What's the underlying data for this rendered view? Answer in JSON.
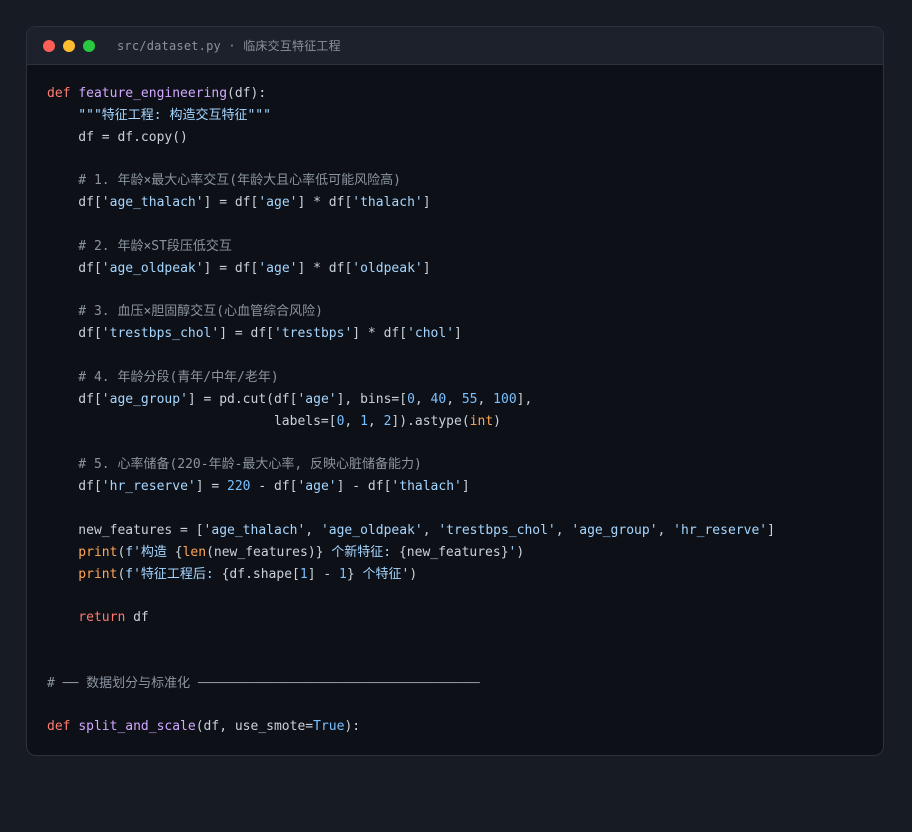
{
  "window": {
    "title": "src/dataset.py · 临床交互特征工程",
    "colors": {
      "close": "#ff5f57",
      "minimize": "#febc2e",
      "maximize": "#28c840",
      "background": "#0d1017",
      "keyword": "#ff7b72",
      "function": "#d2a8ff",
      "string": "#a5d6ff",
      "number": "#79c0ff",
      "comment": "#8b949e",
      "builtin": "#ffa657",
      "plain": "#c9d1d9"
    }
  },
  "code": {
    "lines": [
      [
        [
          "kw",
          "def "
        ],
        [
          "fn",
          "feature_engineering"
        ],
        [
          "pl",
          "(df):"
        ]
      ],
      [
        [
          "str",
          "    \"\"\"特征工程: 构造交互特征\"\"\""
        ]
      ],
      [
        [
          "pl",
          "    df = df.copy()"
        ]
      ],
      [],
      [
        [
          "cm",
          "    # 1. 年龄×最大心率交互(年龄大且心率低可能风险高)"
        ]
      ],
      [
        [
          "pl",
          "    df["
        ],
        [
          "str",
          "'age_thalach'"
        ],
        [
          "pl",
          "] = df["
        ],
        [
          "str",
          "'age'"
        ],
        [
          "pl",
          "] * df["
        ],
        [
          "str",
          "'thalach'"
        ],
        [
          "pl",
          "]"
        ]
      ],
      [],
      [
        [
          "cm",
          "    # 2. 年龄×ST段压低交互"
        ]
      ],
      [
        [
          "pl",
          "    df["
        ],
        [
          "str",
          "'age_oldpeak'"
        ],
        [
          "pl",
          "] = df["
        ],
        [
          "str",
          "'age'"
        ],
        [
          "pl",
          "] * df["
        ],
        [
          "str",
          "'oldpeak'"
        ],
        [
          "pl",
          "]"
        ]
      ],
      [],
      [
        [
          "cm",
          "    # 3. 血压×胆固醇交互(心血管综合风险)"
        ]
      ],
      [
        [
          "pl",
          "    df["
        ],
        [
          "str",
          "'trestbps_chol'"
        ],
        [
          "pl",
          "] = df["
        ],
        [
          "str",
          "'trestbps'"
        ],
        [
          "pl",
          "] * df["
        ],
        [
          "str",
          "'chol'"
        ],
        [
          "pl",
          "]"
        ]
      ],
      [],
      [
        [
          "cm",
          "    # 4. 年龄分段(青年/中年/老年)"
        ]
      ],
      [
        [
          "pl",
          "    df["
        ],
        [
          "str",
          "'age_group'"
        ],
        [
          "pl",
          "] = pd.cut(df["
        ],
        [
          "str",
          "'age'"
        ],
        [
          "pl",
          "], bins=["
        ],
        [
          "num",
          "0"
        ],
        [
          "pl",
          ", "
        ],
        [
          "num",
          "40"
        ],
        [
          "pl",
          ", "
        ],
        [
          "num",
          "55"
        ],
        [
          "pl",
          ", "
        ],
        [
          "num",
          "100"
        ],
        [
          "pl",
          "],"
        ]
      ],
      [
        [
          "pl",
          "                             labels=["
        ],
        [
          "num",
          "0"
        ],
        [
          "pl",
          ", "
        ],
        [
          "num",
          "1"
        ],
        [
          "pl",
          ", "
        ],
        [
          "num",
          "2"
        ],
        [
          "pl",
          "]).astype("
        ],
        [
          "bi",
          "int"
        ],
        [
          "pl",
          ")"
        ]
      ],
      [],
      [
        [
          "cm",
          "    # 5. 心率储备(220-年龄-最大心率, 反映心脏储备能力)"
        ]
      ],
      [
        [
          "pl",
          "    df["
        ],
        [
          "str",
          "'hr_reserve'"
        ],
        [
          "pl",
          "] = "
        ],
        [
          "num",
          "220"
        ],
        [
          "pl",
          " - df["
        ],
        [
          "str",
          "'age'"
        ],
        [
          "pl",
          "] - df["
        ],
        [
          "str",
          "'thalach'"
        ],
        [
          "pl",
          "]"
        ]
      ],
      [],
      [
        [
          "pl",
          "    new_features = ["
        ],
        [
          "str",
          "'age_thalach'"
        ],
        [
          "pl",
          ", "
        ],
        [
          "str",
          "'age_oldpeak'"
        ],
        [
          "pl",
          ", "
        ],
        [
          "str",
          "'trestbps_chol'"
        ],
        [
          "pl",
          ", "
        ],
        [
          "str",
          "'age_group'"
        ],
        [
          "pl",
          ", "
        ],
        [
          "str",
          "'hr_reserve'"
        ],
        [
          "pl",
          "]"
        ]
      ],
      [
        [
          "bi",
          "    print"
        ],
        [
          "pl",
          "("
        ],
        [
          "str",
          "f'构造 "
        ],
        [
          "pl",
          "{"
        ],
        [
          "bi",
          "len"
        ],
        [
          "pl",
          "(new_features)}"
        ],
        [
          "str",
          " 个新特征: "
        ],
        [
          "pl",
          "{new_features}"
        ],
        [
          "str",
          "'"
        ],
        [
          "pl",
          ")"
        ]
      ],
      [
        [
          "bi",
          "    print"
        ],
        [
          "pl",
          "("
        ],
        [
          "str",
          "f'特征工程后: "
        ],
        [
          "pl",
          "{df.shape["
        ],
        [
          "num",
          "1"
        ],
        [
          "pl",
          "] - "
        ],
        [
          "num",
          "1"
        ],
        [
          "pl",
          "}"
        ],
        [
          "str",
          " 个特征'"
        ],
        [
          "pl",
          ")"
        ]
      ],
      [],
      [
        [
          "kw",
          "    return"
        ],
        [
          "pl",
          " df"
        ]
      ],
      [],
      [],
      [
        [
          "cm",
          "# ── 数据划分与标准化 ────────────────────────────────────"
        ]
      ],
      [],
      [
        [
          "kw",
          "def "
        ],
        [
          "fn",
          "split_and_scale"
        ],
        [
          "pl",
          "(df, use_smote="
        ],
        [
          "num",
          "True"
        ],
        [
          "pl",
          "):"
        ]
      ]
    ]
  }
}
